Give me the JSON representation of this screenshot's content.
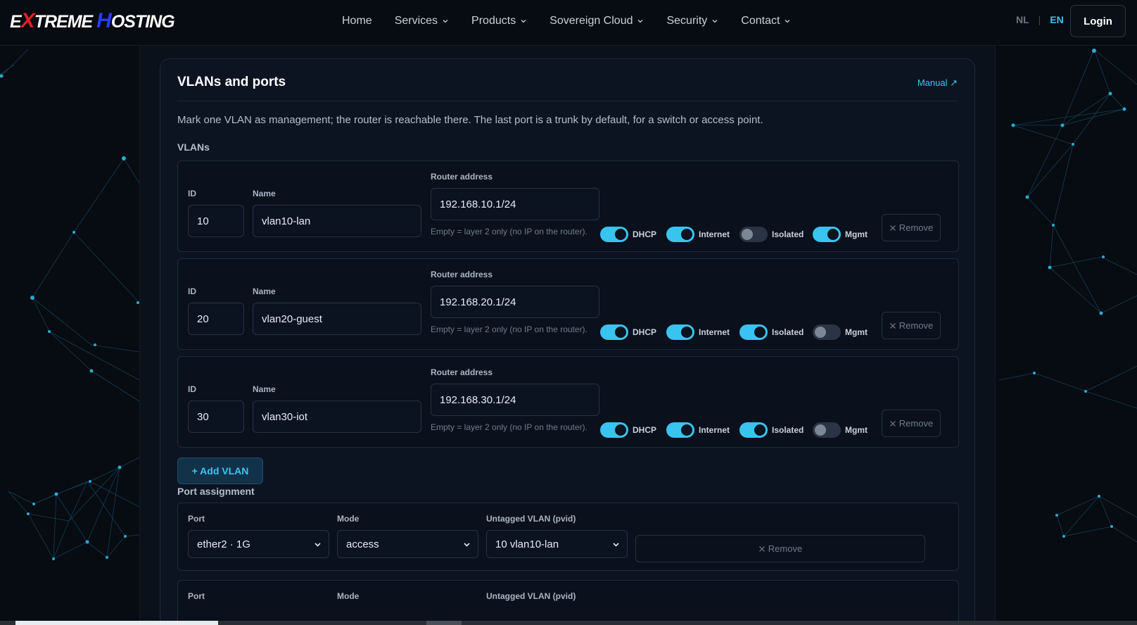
{
  "header": {
    "logo": "EXTREME HOSTING",
    "nav": [
      {
        "label": "Home",
        "dropdown": false
      },
      {
        "label": "Services",
        "dropdown": true
      },
      {
        "label": "Products",
        "dropdown": true
      },
      {
        "label": "Sovereign Cloud",
        "dropdown": true
      },
      {
        "label": "Security",
        "dropdown": true
      },
      {
        "label": "Contact",
        "dropdown": true
      }
    ],
    "lang_nl": "NL",
    "lang_sep": "|",
    "lang_en": "EN",
    "login": "Login"
  },
  "card": {
    "title": "VLANs and ports",
    "manual": "Manual ↗",
    "intro": "Mark one VLAN as management; the router is reachable there. The last port is a trunk by default, for a switch or access point.",
    "vlans_label": "VLANs",
    "ports_label": "Port assignment"
  },
  "vlan_labels": {
    "id": "ID",
    "name": "Name",
    "router_address": "Router address",
    "hint": "Empty = layer 2 only (no IP on the router).",
    "dhcp": "DHCP",
    "internet": "Internet",
    "isolated": "Isolated",
    "mgmt": "Mgmt",
    "remove": "Remove"
  },
  "vlans": [
    {
      "id": "10",
      "name": "vlan10-lan",
      "address": "192.168.10.1/24",
      "dhcp": true,
      "internet": true,
      "isolated": false,
      "mgmt": true
    },
    {
      "id": "20",
      "name": "vlan20-guest",
      "address": "192.168.20.1/24",
      "dhcp": true,
      "internet": true,
      "isolated": true,
      "mgmt": false
    },
    {
      "id": "30",
      "name": "vlan30-iot",
      "address": "192.168.30.1/24",
      "dhcp": true,
      "internet": true,
      "isolated": true,
      "mgmt": false
    }
  ],
  "add_vlan": "+ Add VLAN",
  "port_labels": {
    "port": "Port",
    "mode": "Mode",
    "pvid": "Untagged VLAN (pvid)",
    "remove": "Remove"
  },
  "ports": [
    {
      "port": "ether2 · 1G",
      "mode": "access",
      "pvid": "10 vlan10-lan"
    }
  ],
  "colors": {
    "accent": "#3fc4f0",
    "background": "#070b12",
    "card": "#0c1421",
    "toggle_on": "#39c3ef",
    "toggle_off": "#2a3444"
  },
  "icons": {
    "chevron": "chevron-down-icon",
    "remove": "close-icon",
    "external": "external-link-icon"
  }
}
